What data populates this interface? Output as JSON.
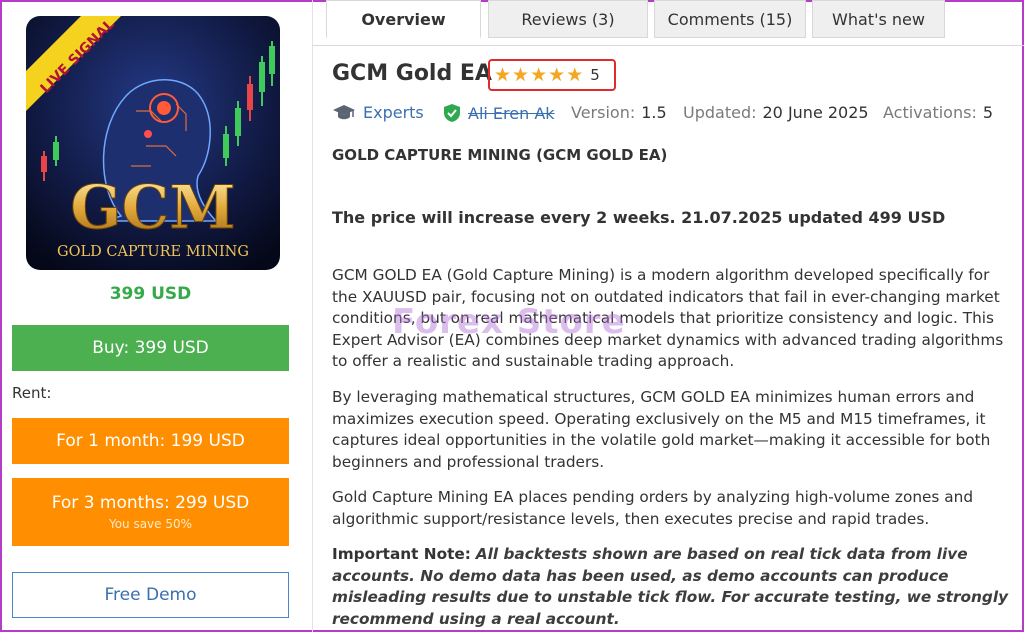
{
  "product": {
    "image": {
      "badge": "LIVE SIGNAL",
      "logo_text": "GCM",
      "logo_subtitle": "GOLD CAPTURE MINING"
    },
    "price": "399 USD",
    "buy_label": "Buy: 399 USD",
    "rent_label": "Rent:",
    "rent_1_label": "For 1 month: 199 USD",
    "rent_3_label": "For 3 months: 299 USD",
    "rent_3_save": "You save 50%",
    "demo_label": "Free Demo"
  },
  "tabs": [
    {
      "label": "Overview",
      "active": true
    },
    {
      "label": "Reviews (3)",
      "active": false
    },
    {
      "label": "Comments (15)",
      "active": false
    },
    {
      "label": "What's new",
      "active": false
    }
  ],
  "header": {
    "title": "GCM Gold EA",
    "rating": 5,
    "rating_text": "5",
    "category": "Experts",
    "author": "Ali Eren Ak",
    "version_label": "Version:",
    "version": "1.5",
    "updated_label": "Updated:",
    "updated": "20 June 2025",
    "activations_label": "Activations:",
    "activations": "5"
  },
  "content": {
    "heading": "GOLD CAPTURE MINING (GCM GOLD EA)",
    "price_note": "The price will increase every 2 weeks. 21.07.2025 updated 499 USD",
    "paragraph_1": "GCM GOLD EA (Gold Capture Mining) is a modern algorithm developed specifically for the XAUUSD pair, focusing not on outdated indicators that fail in ever-changing market conditions, but on real mathematical models that prioritize consistency and logic. This Expert Advisor (EA) combines deep market dynamics with advanced trading algorithms to offer a realistic and sustainable trading approach.",
    "paragraph_2": "By leveraging mathematical structures, GCM GOLD EA minimizes human errors and maximizes execution speed. Operating exclusively on the M5 and M15 timeframes, it captures ideal opportunities in the volatile gold market—making it accessible for both beginners and professional traders.",
    "paragraph_3": "Gold Capture Mining EA places pending orders by analyzing high-volume zones and algorithmic support/resistance levels, then executes precise and rapid trades.",
    "note_label": "Important Note:",
    "note_text": "All backtests shown are based on real tick data from live accounts. No demo data has been used, as demo accounts can produce misleading results due to unstable tick flow. For accurate testing, we strongly recommend using a real account."
  },
  "watermark": "Forex Store",
  "colors": {
    "buy": "#4caf50",
    "rent": "#ff8f00",
    "price": "#36a94a",
    "link": "#3a6fb0",
    "star": "#f5a623",
    "highlight": "#e02b2b"
  }
}
